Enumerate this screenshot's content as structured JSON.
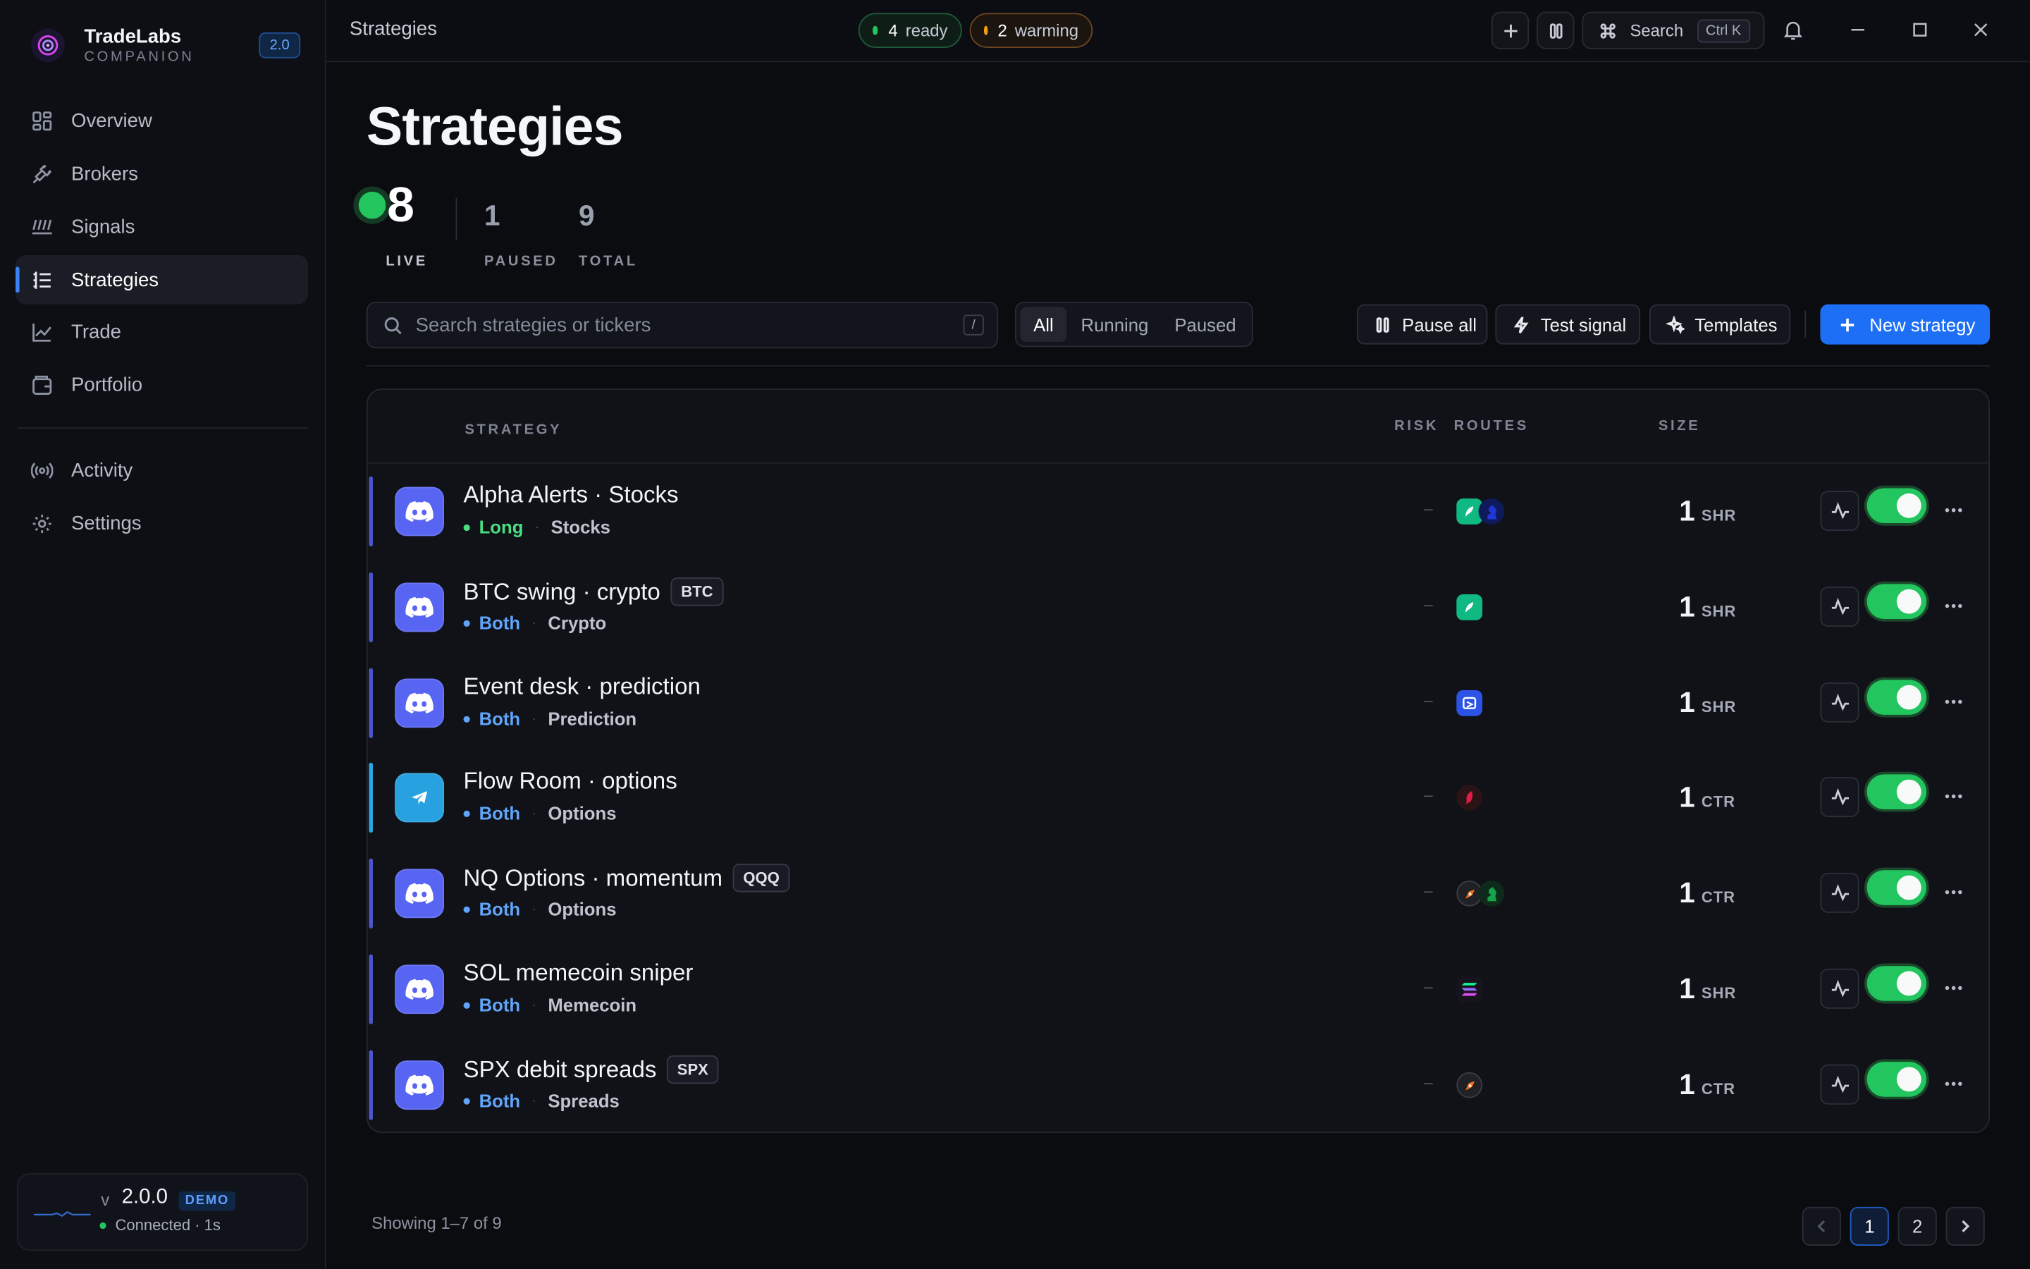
{
  "brand": {
    "name": "TradeLabs",
    "sub": "COMPANION",
    "badge": "2.0"
  },
  "sidebar": {
    "items": [
      {
        "label": "Overview",
        "icon": "grid-icon"
      },
      {
        "label": "Brokers",
        "icon": "plug-icon"
      },
      {
        "label": "Signals",
        "icon": "signal-icon"
      },
      {
        "label": "Strategies",
        "icon": "list-icon",
        "active": true
      },
      {
        "label": "Trade",
        "icon": "chart-line-icon"
      },
      {
        "label": "Portfolio",
        "icon": "wallet-icon"
      },
      {
        "label": "Activity",
        "icon": "broadcast-icon"
      },
      {
        "label": "Settings",
        "icon": "gear-icon"
      }
    ],
    "version": {
      "v": "v",
      "num": "2.0.0",
      "demo": "DEMO",
      "status": "Connected · 1s"
    }
  },
  "topbar": {
    "crumb": "Strategies",
    "ready": {
      "count": "4",
      "label": "ready"
    },
    "warming": {
      "count": "2",
      "label": "warming"
    },
    "search_label": "Search",
    "shortcut": "Ctrl K"
  },
  "page": {
    "title": "Strategies",
    "stats": [
      {
        "value": "8",
        "label": "LIVE"
      },
      {
        "value": "1",
        "label": "PAUSED"
      },
      {
        "value": "9",
        "label": "TOTAL"
      }
    ],
    "search_placeholder": "Search strategies or tickers",
    "search_key": "/",
    "filters": [
      "All",
      "Running",
      "Paused"
    ],
    "actions": {
      "pause_all": "Pause all",
      "test_signal": "Test signal",
      "templates": "Templates",
      "new_strategy": "New strategy"
    }
  },
  "table": {
    "headers": {
      "strategy": "STRATEGY",
      "risk": "RISK",
      "routes": "ROUTES",
      "size": "SIZE"
    },
    "rows": [
      {
        "name": "Alpha Alerts · Stocks",
        "ticker": "",
        "direction": "Long",
        "category": "Stocks",
        "risk": "–",
        "size": "1",
        "unit": "SHR",
        "source": "discord",
        "enabled": true
      },
      {
        "name": "BTC swing · crypto",
        "ticker": "BTC",
        "direction": "Both",
        "category": "Crypto",
        "risk": "–",
        "size": "1",
        "unit": "SHR",
        "source": "discord",
        "enabled": true
      },
      {
        "name": "Event desk · prediction",
        "ticker": "",
        "direction": "Both",
        "category": "Prediction",
        "risk": "–",
        "size": "1",
        "unit": "SHR",
        "source": "discord",
        "enabled": true
      },
      {
        "name": "Flow Room · options",
        "ticker": "",
        "direction": "Both",
        "category": "Options",
        "risk": "–",
        "size": "1",
        "unit": "CTR",
        "source": "telegram",
        "enabled": true
      },
      {
        "name": "NQ Options · momentum",
        "ticker": "QQQ",
        "direction": "Both",
        "category": "Options",
        "risk": "–",
        "size": "1",
        "unit": "CTR",
        "source": "discord",
        "enabled": true
      },
      {
        "name": "SOL memecoin sniper",
        "ticker": "",
        "direction": "Both",
        "category": "Memecoin",
        "risk": "–",
        "size": "1",
        "unit": "SHR",
        "source": "discord",
        "enabled": true
      },
      {
        "name": "SPX debit spreads",
        "ticker": "SPX",
        "direction": "Both",
        "category": "Spreads",
        "risk": "–",
        "size": "1",
        "unit": "CTR",
        "source": "discord",
        "enabled": true
      }
    ]
  },
  "footer": {
    "showing": "Showing 1–7 of 9",
    "pages": [
      "1",
      "2"
    ]
  },
  "colors": {
    "accent": "#1d6ff5",
    "live": "#22c55e",
    "long": "#4ade80",
    "both": "#60a5fa",
    "discord": "#5865f2",
    "telegram": "#27a1df"
  }
}
